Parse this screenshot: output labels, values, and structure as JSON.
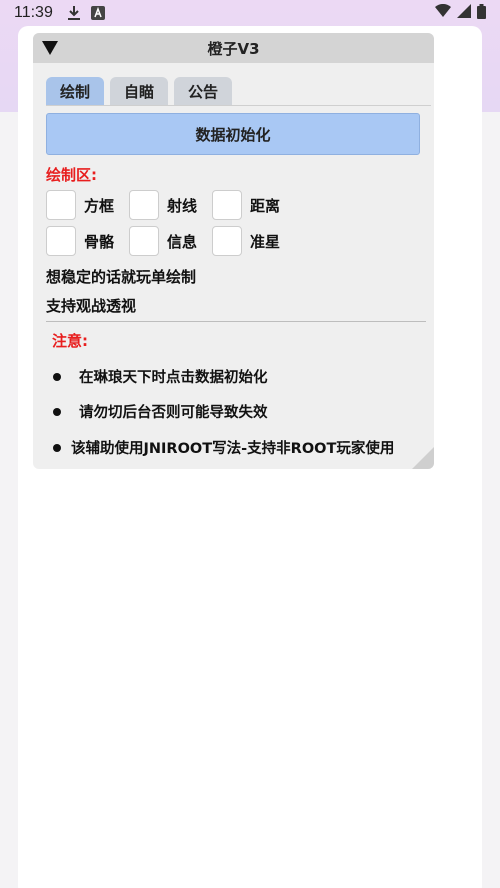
{
  "status_bar": {
    "time": "11:39",
    "left_icons": [
      "download-icon",
      "text-a-icon"
    ],
    "right_icons": [
      "wifi-icon",
      "signal-icon",
      "battery-icon"
    ]
  },
  "window": {
    "title": "橙子V3",
    "tabs": [
      {
        "label": "绘制",
        "active": true
      },
      {
        "label": "自瞄",
        "active": false
      },
      {
        "label": "公告",
        "active": false
      }
    ],
    "init_button": "数据初始化",
    "draw_section_label": "绘制区:",
    "checkboxes_row1": [
      {
        "label": "方框"
      },
      {
        "label": "射线"
      },
      {
        "label": "距离"
      }
    ],
    "checkboxes_row2": [
      {
        "label": "骨骼"
      },
      {
        "label": "信息"
      },
      {
        "label": "准星"
      }
    ],
    "hint_line1": "想稳定的话就玩单绘制",
    "hint_line2": "支持观战透视",
    "notice_label": "注意:",
    "notices": [
      "在琳琅天下时点击数据初始化",
      "请勿切后台否则可能导致失效",
      "该辅助使用JNIROOT写法-支持非ROOT玩家使用"
    ]
  },
  "colors": {
    "accent_tab": "#a9c4ea",
    "button": "#a9c8f4",
    "warning_text": "#e81e1e",
    "header": "#d4d4d4"
  }
}
